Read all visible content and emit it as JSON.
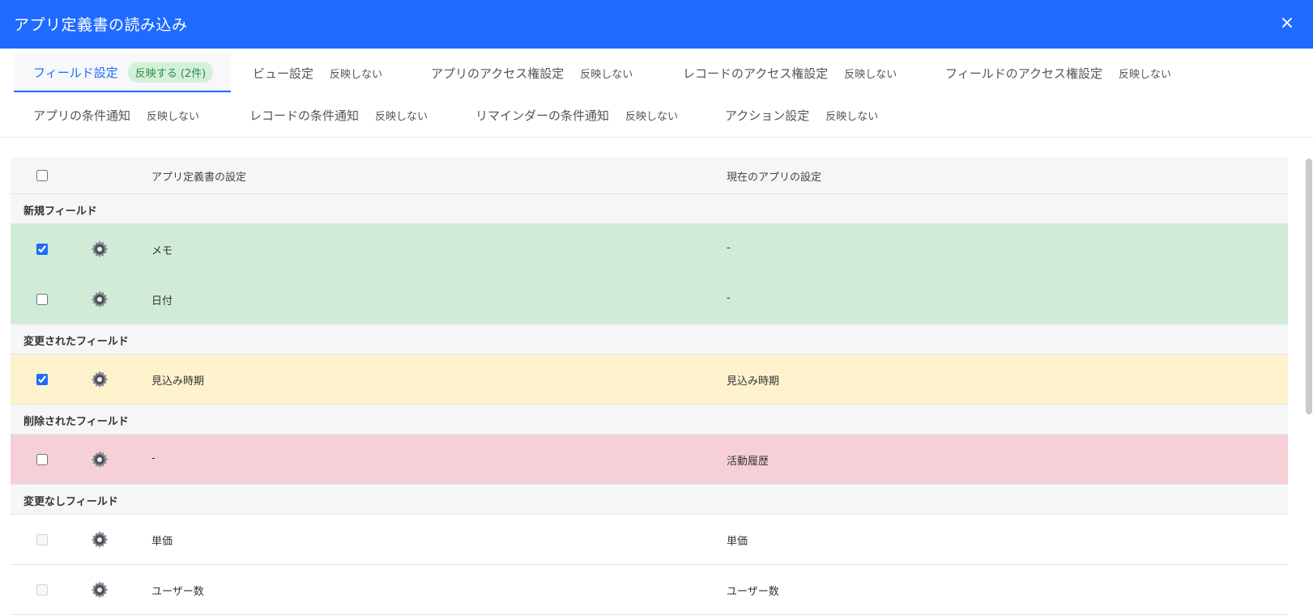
{
  "dialog": {
    "title": "アプリ定義書の読み込み",
    "close_icon": "×"
  },
  "tabs": [
    {
      "label": "フィールド設定",
      "status": "反映する (2件)",
      "active": true
    },
    {
      "label": "ビュー設定",
      "status": "反映しない"
    },
    {
      "label": "アプリのアクセス権設定",
      "status": "反映しない"
    },
    {
      "label": "レコードのアクセス権設定",
      "status": "反映しない"
    },
    {
      "label": "フィールドのアクセス権設定",
      "status": "反映しない"
    },
    {
      "label": "アプリの条件通知",
      "status": "反映しない"
    },
    {
      "label": "レコードの条件通知",
      "status": "反映しない"
    },
    {
      "label": "リマインダーの条件通知",
      "status": "反映しない"
    },
    {
      "label": "アクション設定",
      "status": "反映しない"
    }
  ],
  "table": {
    "headers": {
      "definition": "アプリ定義書の設定",
      "current": "現在のアプリの設定"
    },
    "sections": {
      "new": "新規フィールド",
      "changed": "変更されたフィールド",
      "deleted": "削除されたフィールド",
      "unchanged": "変更なしフィールド"
    },
    "rows": {
      "memo": {
        "definition": "メモ",
        "current": "-",
        "checked": true
      },
      "date": {
        "definition": "日付",
        "current": "-",
        "checked": false
      },
      "forecast": {
        "definition": "見込み時期",
        "current": "見込み時期",
        "checked": true
      },
      "history": {
        "definition": "-",
        "current": "活動履歴",
        "checked": false
      },
      "price": {
        "definition": "単価",
        "current": "単価",
        "checked": false,
        "disabled": true
      },
      "users": {
        "definition": "ユーザー数",
        "current": "ユーザー数",
        "checked": false,
        "disabled": true
      }
    }
  },
  "colors": {
    "accent": "#1f6bff",
    "new_row": "#d0ecd6",
    "changed_row": "#fdf2cc",
    "deleted_row": "#f5d0d6",
    "badge_bg": "#d4f0d9",
    "badge_text": "#2e8b47"
  },
  "icons": {
    "field_type": "gear-icon",
    "close": "close-icon"
  }
}
